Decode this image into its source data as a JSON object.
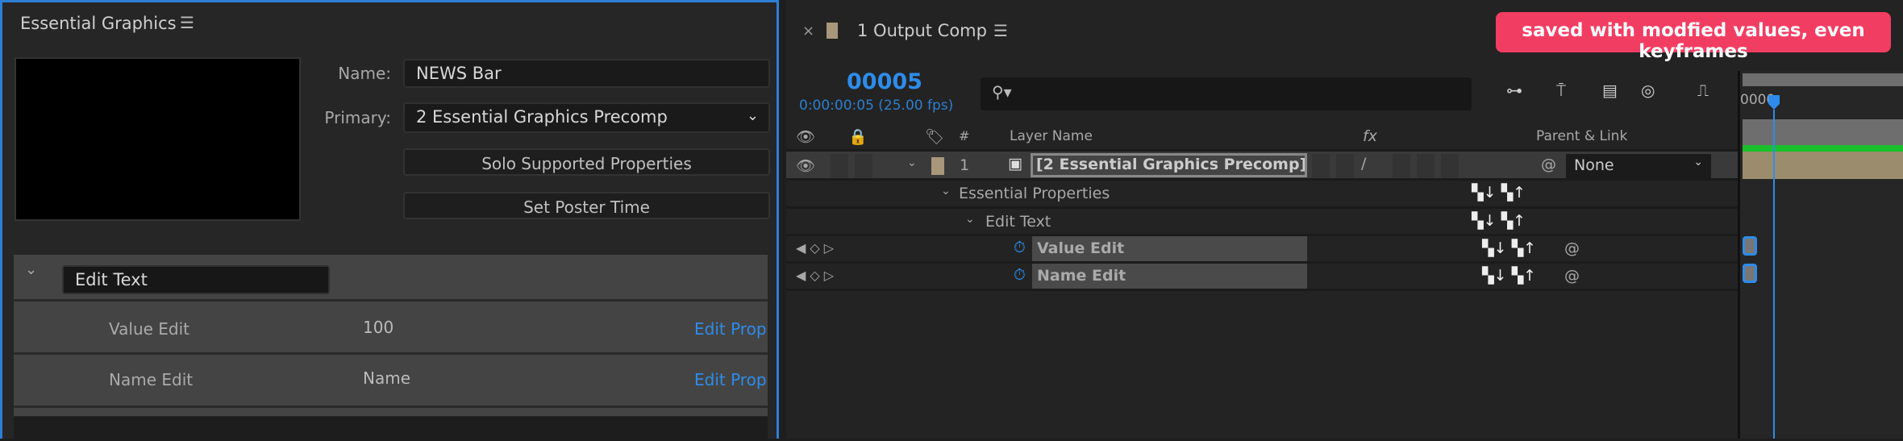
{
  "eg_panel": {
    "title": "Essential Graphics",
    "name_label": "Name:",
    "name_value": "NEWS Bar",
    "primary_label": "Primary:",
    "primary_value": "2 Essential Graphics Precomp",
    "solo_button": "Solo Supported Properties",
    "poster_button": "Set Poster Time",
    "group_name": "Edit Text",
    "properties": [
      {
        "name": "Value Edit",
        "value": "100",
        "action": "Edit Prop"
      },
      {
        "name": "Name Edit",
        "value": "Name",
        "action": "Edit Prop"
      }
    ]
  },
  "timeline": {
    "close": "×",
    "tab_title": "1 Output Comp",
    "annotation": "saved with modfied values, even keyframes",
    "timecode": "00005",
    "timecode_detail": "0:00:00:05 (25.00 fps)",
    "ruler_label": "0000",
    "headers": {
      "number": "#",
      "layer_name": "Layer Name",
      "parent": "Parent & Link",
      "fx": "fx"
    },
    "layer": {
      "number": "1",
      "name": "[2 Essential Graphics Precomp]",
      "parent": "None"
    },
    "groups": [
      "Essential Properties",
      "Edit Text"
    ],
    "properties": [
      "Value Edit",
      "Name Edit"
    ],
    "colors": {
      "accent": "#2d8ceb",
      "badge": "#f23d62",
      "label": "#a8977a"
    }
  }
}
